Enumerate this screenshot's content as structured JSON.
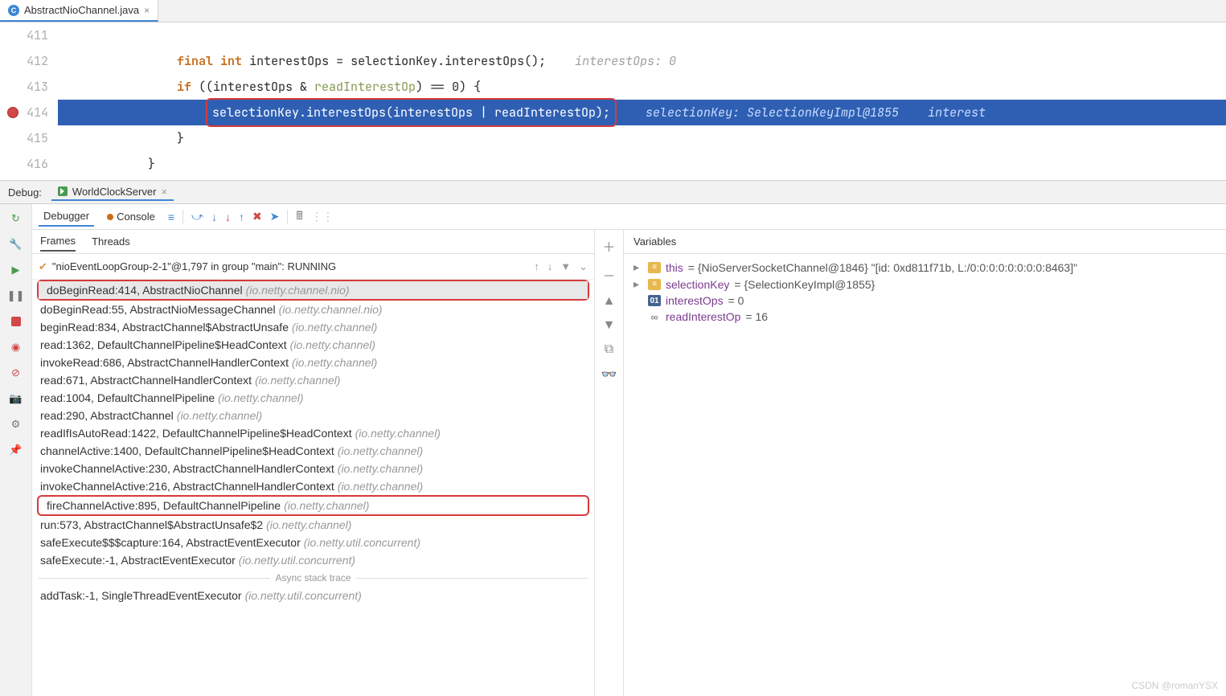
{
  "tab": {
    "filename": "AbstractNioChannel.java"
  },
  "gutter": [
    "411",
    "412",
    "413",
    "414",
    "415",
    "416"
  ],
  "code": {
    "l412_kw1": "final",
    "l412_kw2": "int",
    "l412_rest": " interestOps = selectionKey.interestOps();",
    "l412_hint": "interestOps: 0",
    "l413_kw": "if",
    "l413a": " ((interestOps & ",
    "l413b": "readInterestOp",
    "l413c": ") == 0) {",
    "l414_stmt": "selectionKey.interestOps(interestOps | readInterestOp);",
    "l414_hint1": "selectionKey: SelectionKeyImpl@1855",
    "l414_hint2": "interest",
    "l415": "}",
    "l416": "}"
  },
  "debug": {
    "label": "Debug:",
    "config": "WorldClockServer",
    "tabs": {
      "debugger": "Debugger",
      "console": "Console"
    },
    "panelTabs": {
      "frames": "Frames",
      "threads": "Threads"
    },
    "thread": "\"nioEventLoopGroup-2-1\"@1,797 in group \"main\": RUNNING",
    "frames": [
      {
        "m": "doBeginRead:414, AbstractNioChannel ",
        "p": "(io.netty.channel.nio)",
        "sel": true,
        "box": true
      },
      {
        "m": "doBeginRead:55, AbstractNioMessageChannel ",
        "p": "(io.netty.channel.nio)"
      },
      {
        "m": "beginRead:834, AbstractChannel$AbstractUnsafe ",
        "p": "(io.netty.channel)"
      },
      {
        "m": "read:1362, DefaultChannelPipeline$HeadContext ",
        "p": "(io.netty.channel)"
      },
      {
        "m": "invokeRead:686, AbstractChannelHandlerContext ",
        "p": "(io.netty.channel)"
      },
      {
        "m": "read:671, AbstractChannelHandlerContext ",
        "p": "(io.netty.channel)"
      },
      {
        "m": "read:1004, DefaultChannelPipeline ",
        "p": "(io.netty.channel)"
      },
      {
        "m": "read:290, AbstractChannel ",
        "p": "(io.netty.channel)"
      },
      {
        "m": "readIfIsAutoRead:1422, DefaultChannelPipeline$HeadContext ",
        "p": "(io.netty.channel)"
      },
      {
        "m": "channelActive:1400, DefaultChannelPipeline$HeadContext ",
        "p": "(io.netty.channel)"
      },
      {
        "m": "invokeChannelActive:230, AbstractChannelHandlerContext ",
        "p": "(io.netty.channel)"
      },
      {
        "m": "invokeChannelActive:216, AbstractChannelHandlerContext ",
        "p": "(io.netty.channel)"
      },
      {
        "m": "fireChannelActive:895, DefaultChannelPipeline ",
        "p": "(io.netty.channel)",
        "box": true
      },
      {
        "m": "run:573, AbstractChannel$AbstractUnsafe$2 ",
        "p": "(io.netty.channel)"
      },
      {
        "m": "safeExecute$$$capture:164, AbstractEventExecutor ",
        "p": "(io.netty.util.concurrent)"
      },
      {
        "m": "safeExecute:-1, AbstractEventExecutor ",
        "p": "(io.netty.util.concurrent)"
      }
    ],
    "asyncLabel": "Async stack trace",
    "asyncFrames": [
      {
        "m": "addTask:-1, SingleThreadEventExecutor ",
        "p": "(io.netty.util.concurrent)"
      }
    ]
  },
  "variables": {
    "title": "Variables",
    "rows": [
      {
        "ico": "obj",
        "arrow": "▸",
        "name": "this",
        "rest": " = {NioServerSocketChannel@1846} \"[id: 0xd811f71b, L:/0:0:0:0:0:0:0:0:8463]\""
      },
      {
        "ico": "obj",
        "arrow": "▸",
        "name": "selectionKey",
        "rest": " = {SelectionKeyImpl@1855}"
      },
      {
        "ico": "int",
        "arrow": "",
        "name": "interestOps",
        "rest": " = 0"
      },
      {
        "ico": "link",
        "arrow": "",
        "name": "readInterestOp",
        "rest": " = 16"
      }
    ]
  },
  "watermark": "CSDN @romanYSX"
}
